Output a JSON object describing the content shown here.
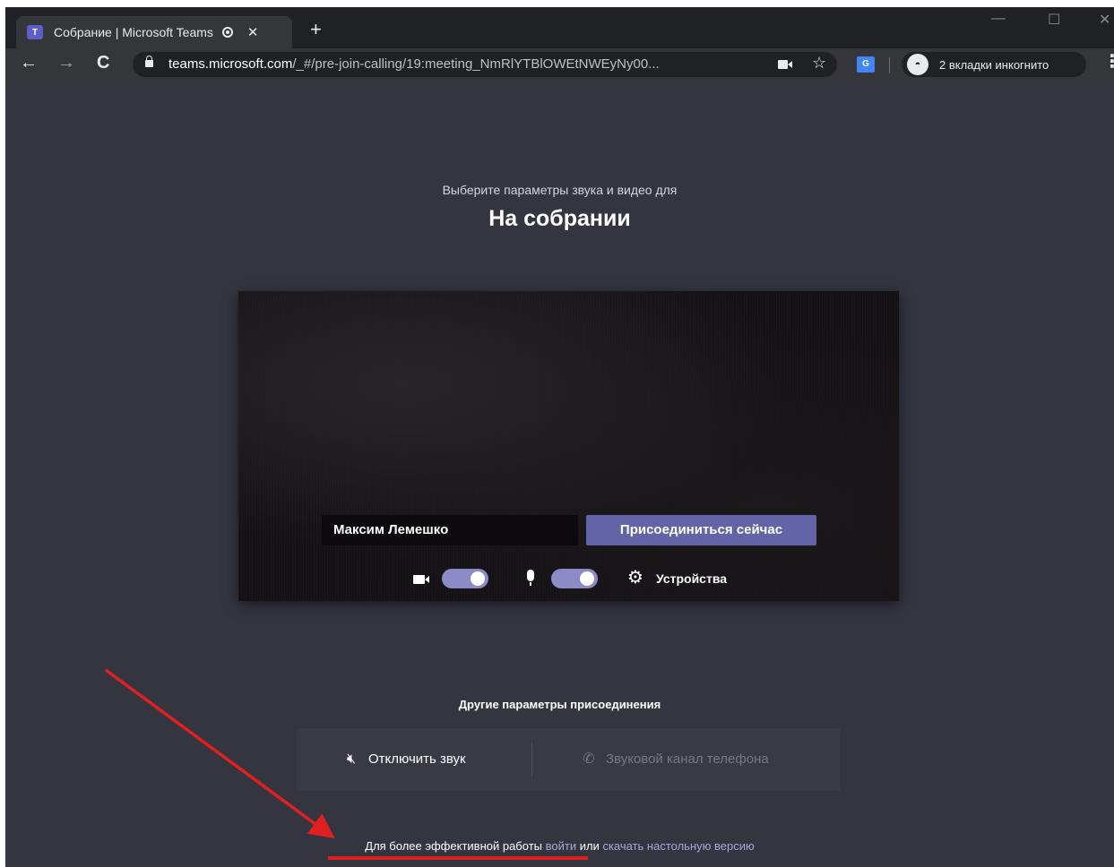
{
  "browser": {
    "tab": {
      "title": "Собрание | Microsoft Teams",
      "logo_text": "T",
      "close": "✕"
    },
    "new_tab": "+",
    "window_controls": {
      "minimize": "—",
      "maximize": "☐",
      "close": "✕"
    },
    "nav": {
      "back": "←",
      "forward": "→",
      "reload": "C"
    },
    "address": {
      "host": "teams.microsoft.com",
      "path": "/_#/pre-join-calling/19:meeting_NmRlYTBlOWEtNWEyNy00..."
    },
    "star": "☆",
    "translate_icon_text": "G",
    "incognito_label": "2 вкладки инкогнито",
    "menu": "⋮"
  },
  "prejoin": {
    "subtitle": "Выберите параметры звука и видео для",
    "title": "На собрании",
    "name_value": "Максим Лемешко",
    "join_label": "Присоединиться сейчас",
    "camera_on": true,
    "mic_on": true,
    "devices_label": "Устройства"
  },
  "other_options": {
    "title": "Другие параметры присоединения",
    "mute_label": "Отключить звук",
    "phone_label": "Звуковой канал телефона"
  },
  "footer": {
    "prefix": "Для более эффективной работы",
    "signin_link": "войти",
    "middle": "или",
    "download_link": "скачать настольную версию"
  },
  "annotation_color": "#e02020"
}
